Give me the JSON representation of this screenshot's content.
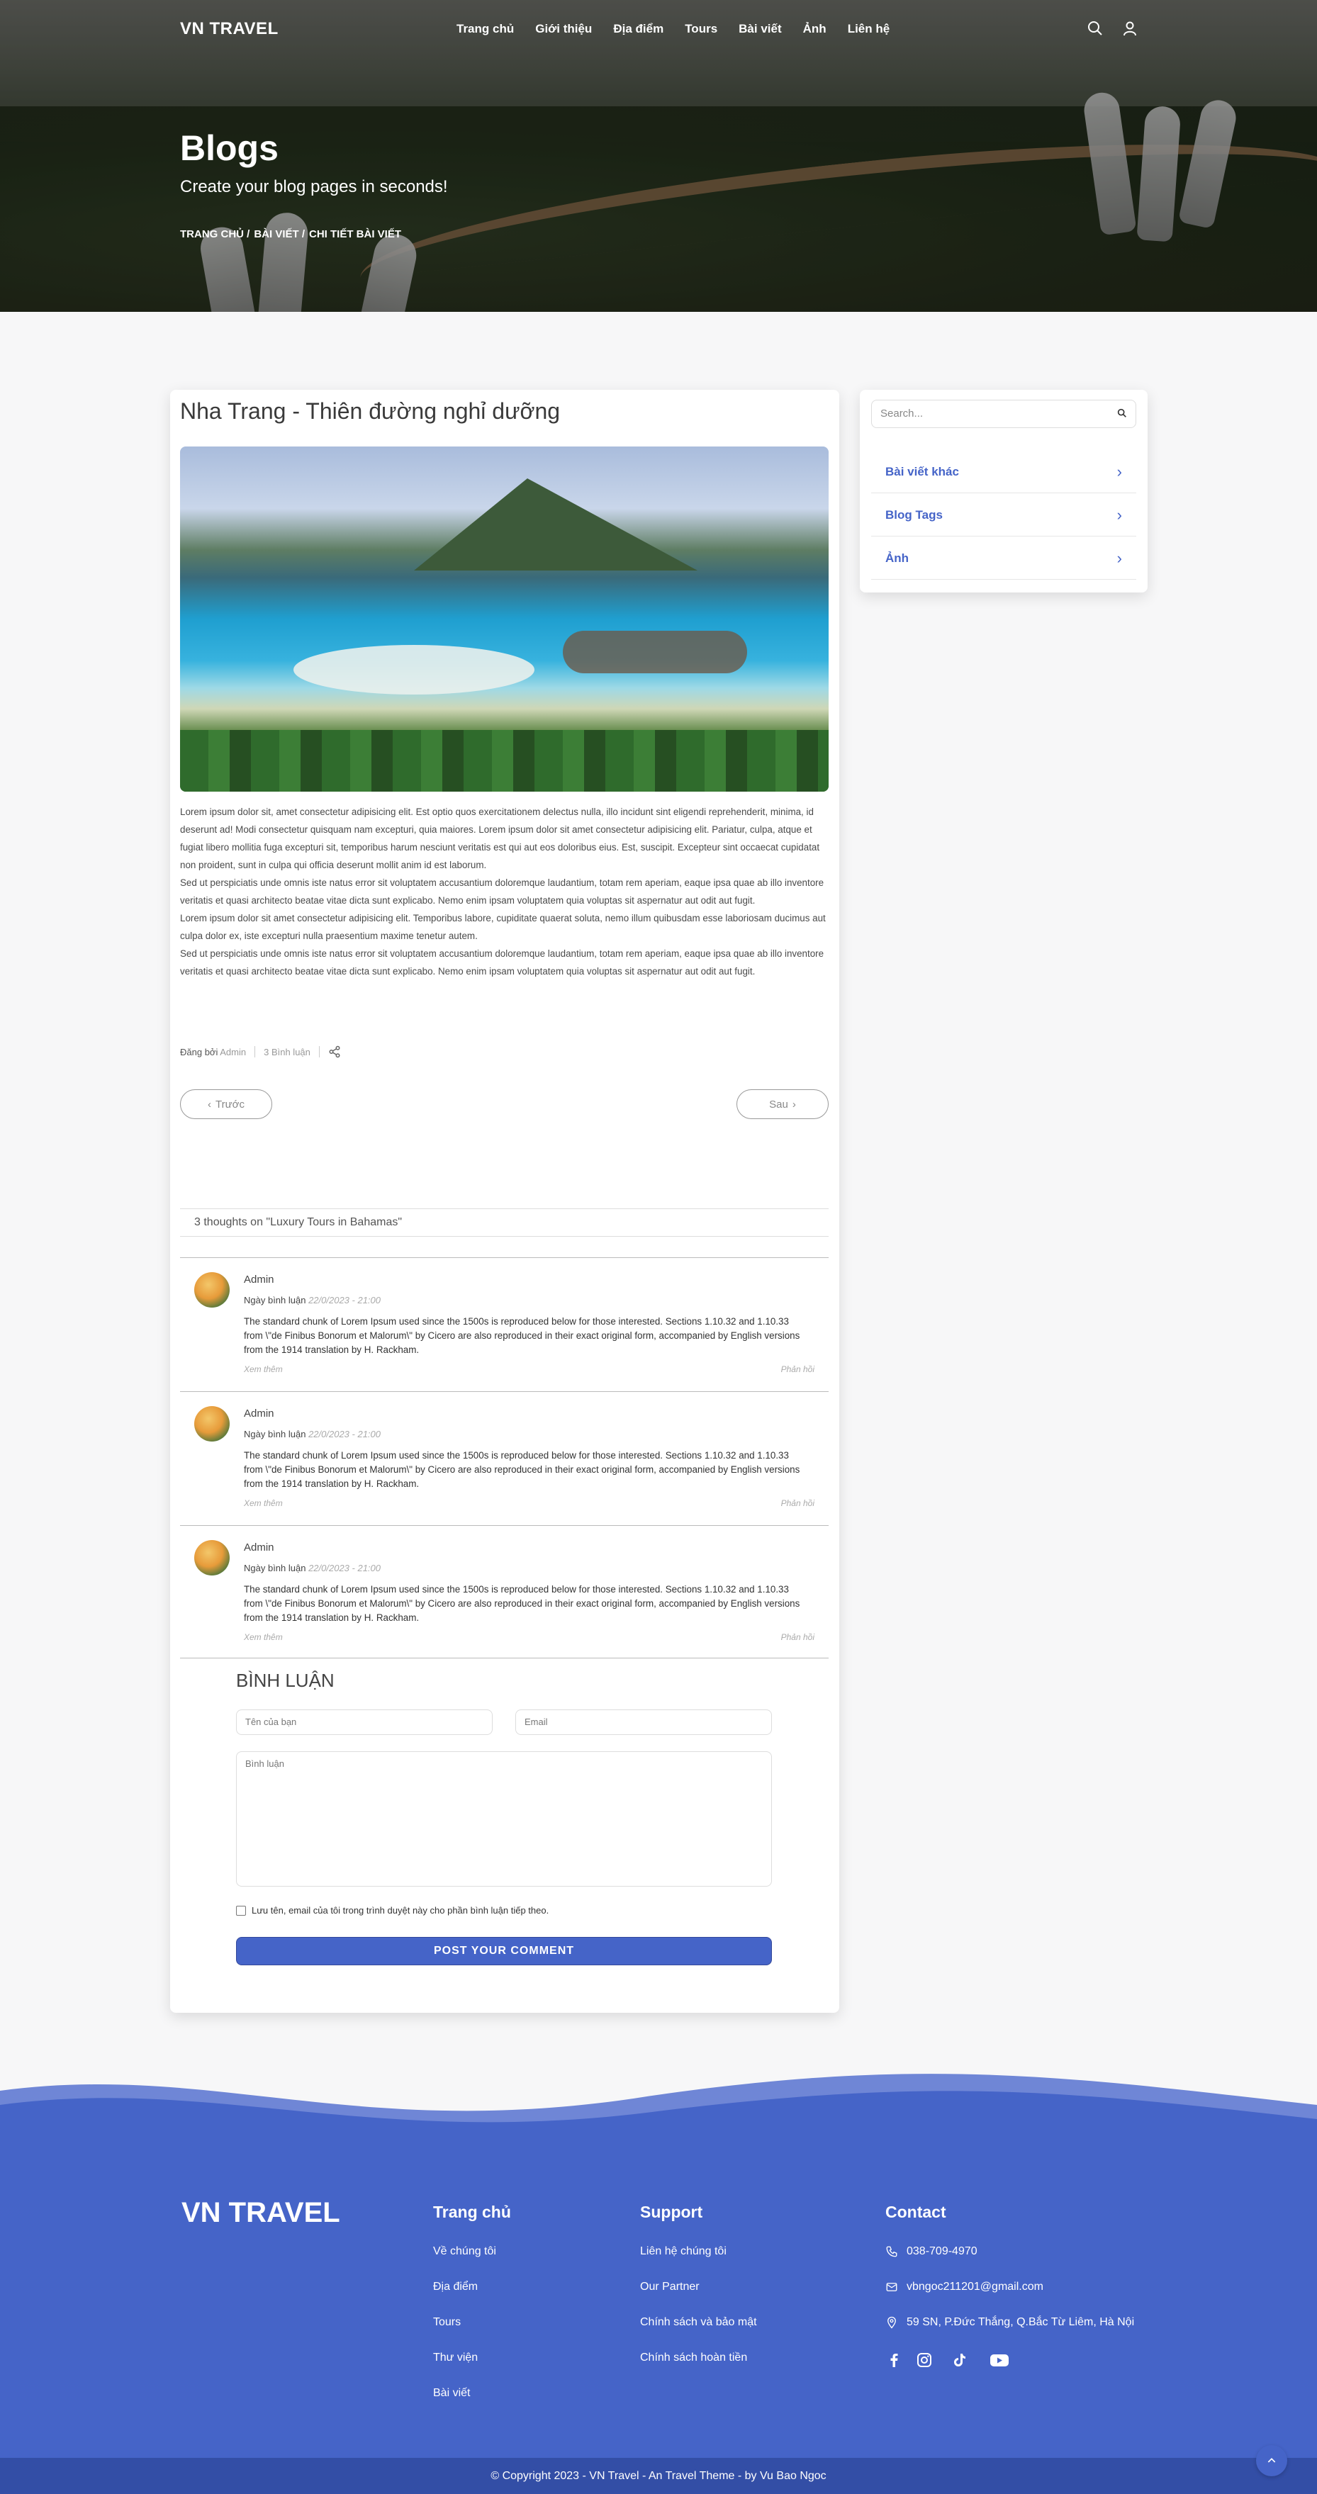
{
  "nav": {
    "brand": "VN TRAVEL",
    "items": [
      "Trang chủ",
      "Giới thiệu",
      "Địa điểm",
      "Tours",
      "Bài viết",
      "Ảnh",
      "Liên hệ"
    ]
  },
  "hero": {
    "title": "Blogs",
    "subtitle": "Create your blog pages in seconds!",
    "breadcrumb": [
      "TRANG CHỦ /",
      "BÀI VIẾT /",
      "CHI TIẾT BÀI VIẾT"
    ]
  },
  "post": {
    "title": "Nha Trang - Thiên đường nghỉ dưỡng",
    "paragraphs": [
      "Lorem ipsum dolor sit, amet consectetur adipisicing elit. Est optio quos exercitationem delectus nulla, illo incidunt sint eligendi reprehenderit, minima, id deserunt ad! Modi consectetur quisquam nam excepturi, quia maiores. Lorem ipsum dolor sit amet consectetur adipisicing elit. Pariatur, culpa, atque et fugiat libero mollitia fuga excepturi sit, temporibus harum nesciunt veritatis est qui aut eos doloribus eius. Est, suscipit. Excepteur sint occaecat cupidatat non proident, sunt in culpa qui officia deserunt mollit anim id est laborum.",
      "Sed ut perspiciatis unde omnis iste natus error sit voluptatem accusantium doloremque laudantium, totam rem aperiam, eaque ipsa quae ab illo inventore veritatis et quasi architecto beatae vitae dicta sunt explicabo. Nemo enim ipsam voluptatem quia voluptas sit aspernatur aut odit aut fugit.",
      "Lorem ipsum dolor sit amet consectetur adipisicing elit. Temporibus labore, cupiditate quaerat soluta, nemo illum quibusdam esse laboriosam ducimus aut culpa dolor ex, iste excepturi nulla praesentium maxime tenetur autem.",
      "Sed ut perspiciatis unde omnis iste natus error sit voluptatem accusantium doloremque laudantium, totam rem aperiam, eaque ipsa quae ab illo inventore veritatis et quasi architecto beatae vitae dicta sunt explicabo. Nemo enim ipsam voluptatem quia voluptas sit aspernatur aut odit aut fugit."
    ],
    "meta": {
      "by_label": "Đăng bởi",
      "author": "Admin",
      "comments": "3 Bình luận"
    },
    "prev_label": "Trước",
    "next_label": "Sau"
  },
  "comments": {
    "heading": "3 thoughts on \"Luxury Tours in Bahamas\"",
    "items": [
      {
        "name": "Admin",
        "date_label": "Ngày bình luận",
        "date": "22/0/2023 - 21:00",
        "text": "The standard chunk of Lorem Ipsum used since the 1500s is reproduced below for those interested. Sections 1.10.32 and 1.10.33 from \\\"de Finibus Bonorum et Malorum\\\" by Cicero are also reproduced in their exact original form, accompanied by English versions from the 1914 translation by H. Rackham.",
        "more": "Xem thêm",
        "reply": "Phản hồi"
      },
      {
        "name": "Admin",
        "date_label": "Ngày bình luận",
        "date": "22/0/2023 - 21:00",
        "text": "The standard chunk of Lorem Ipsum used since the 1500s is reproduced below for those interested. Sections 1.10.32 and 1.10.33 from \\\"de Finibus Bonorum et Malorum\\\" by Cicero are also reproduced in their exact original form, accompanied by English versions from the 1914 translation by H. Rackham.",
        "more": "Xem thêm",
        "reply": "Phản hồi"
      },
      {
        "name": "Admin",
        "date_label": "Ngày bình luận",
        "date": "22/0/2023 - 21:00",
        "text": "The standard chunk of Lorem Ipsum used since the 1500s is reproduced below for those interested. Sections 1.10.32 and 1.10.33 from \\\"de Finibus Bonorum et Malorum\\\" by Cicero are also reproduced in their exact original form, accompanied by English versions from the 1914 translation by H. Rackham.",
        "more": "Xem thêm",
        "reply": "Phản hồi"
      }
    ]
  },
  "form": {
    "title": "BÌNH LUẬN",
    "name_placeholder": "Tên của bạn",
    "email_placeholder": "Email",
    "comment_placeholder": "Bình luận",
    "save_label": "Lưu tên, email của tôi trong trình duyệt này cho phần bình luận tiếp theo.",
    "submit": "POST YOUR COMMENT"
  },
  "sidebar": {
    "search_placeholder": "Search...",
    "items": [
      "Bài viết khác",
      "Blog Tags",
      "Ảnh"
    ]
  },
  "footer": {
    "brand": "VN TRAVEL",
    "col1": {
      "title": "Trang chủ",
      "links": [
        "Về chúng tôi",
        "Địa điểm",
        "Tours",
        "Thư viện",
        "Bài viết"
      ]
    },
    "col2": {
      "title": "Support",
      "links": [
        "Liên hệ chúng tôi",
        "Our Partner",
        "Chính sách và bảo mật",
        "Chính sách hoàn tiền"
      ]
    },
    "col3": {
      "title": "Contact",
      "phone": "038-709-4970",
      "email": "vbngoc211201@gmail.com",
      "address": "59 SN, P.Đức Thắng, Q.Bắc Từ Liêm, Hà Nội"
    },
    "copyright": "© Copyright 2023 - VN Travel - An Travel Theme - by Vu Bao Ngoc"
  },
  "colors": {
    "accent": "#4564c8",
    "footer_dark": "#334ea6"
  },
  "icons": [
    "search-icon",
    "user-icon",
    "share-icon",
    "chevron-left-icon",
    "chevron-right-icon",
    "phone-icon",
    "mail-icon",
    "location-icon",
    "facebook-icon",
    "instagram-icon",
    "tiktok-icon",
    "youtube-icon",
    "arrow-up-icon"
  ]
}
